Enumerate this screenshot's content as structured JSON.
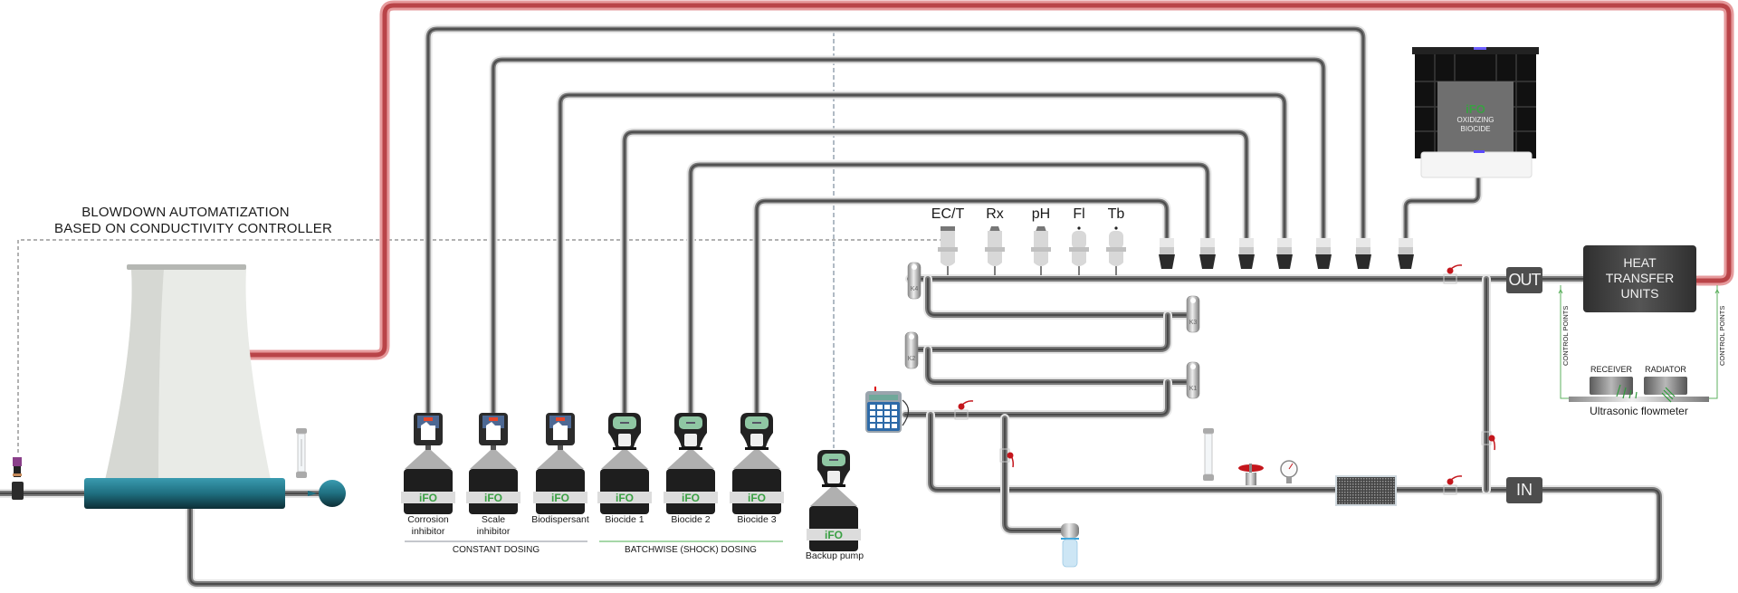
{
  "blowdown": {
    "line1": "BLOWDOWN AUTOMATIZATION",
    "line2": "BASED ON CONDUCTIVITY CONTROLLER"
  },
  "sensors": [
    {
      "id": "ec-t",
      "label": "EC/T"
    },
    {
      "id": "rx",
      "label": "Rx"
    },
    {
      "id": "ph",
      "label": "pH"
    },
    {
      "id": "fl",
      "label": "Fl"
    },
    {
      "id": "tb",
      "label": "Tb"
    }
  ],
  "pumps": [
    {
      "id": "corrosion-inhibitor",
      "label_line1": "Corrosion",
      "label_line2": "inhibitor",
      "type": "constant"
    },
    {
      "id": "scale-inhibitor",
      "label_line1": "Scale",
      "label_line2": "inhibitor",
      "type": "constant"
    },
    {
      "id": "biodispersant",
      "label_line1": "Biodispersant",
      "label_line2": "",
      "type": "constant"
    },
    {
      "id": "biocide-1",
      "label_line1": "Biocide 1",
      "label_line2": "",
      "type": "batch"
    },
    {
      "id": "biocide-2",
      "label_line1": "Biocide 2",
      "label_line2": "",
      "type": "batch"
    },
    {
      "id": "biocide-3",
      "label_line1": "Biocide 3",
      "label_line2": "",
      "type": "batch"
    }
  ],
  "backup_pump": {
    "label": "Backup pump"
  },
  "brand": "iFO",
  "groups": {
    "constant": "CONSTANT DOSING",
    "batch": "BATCHWISE (SHOCK) DOSING"
  },
  "tank": {
    "line1": "OXIDIZING",
    "line2": "BIOCIDE"
  },
  "heat_transfer": {
    "line1": "HEAT",
    "line2": "TRANSFER",
    "line3": "UNITS"
  },
  "ports": {
    "out": "OUT",
    "in": "IN"
  },
  "coupons": [
    "K4",
    "K3",
    "K2",
    "K1"
  ],
  "flowmeter": {
    "receiver": "RECEIVER",
    "radiator": "RADIATOR",
    "label": "Ultrasonic flowmeter",
    "control_points": "CONTROL POINTS"
  },
  "colors": {
    "hot_pipe": "#d9575c",
    "pipe": "#7a7a7a",
    "teal": "#2a7f90",
    "green_line": "#4caf50",
    "brand_green": "#3aa043",
    "valve_red": "#c4161c"
  }
}
